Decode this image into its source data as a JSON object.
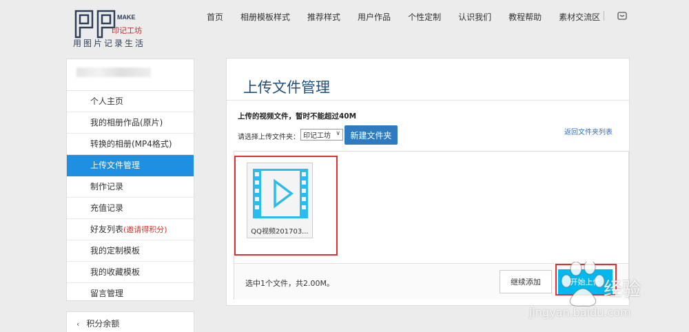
{
  "header": {
    "logo_text": "MAKE",
    "logo_brand": "印记工坊",
    "tagline": "用图片记录生活",
    "nav": [
      "首页",
      "相册模板样式",
      "推荐样式",
      "用户作品",
      "个性定制",
      "认识我们",
      "教程帮助",
      "素材交流区"
    ]
  },
  "sidebar": {
    "items": [
      {
        "label": "个人主页"
      },
      {
        "label": "我的相册作品(原片)"
      },
      {
        "label": "转换的相册(MP4格式)"
      },
      {
        "label": "上传文件管理"
      },
      {
        "label": "制作记录"
      },
      {
        "label": "充值记录"
      },
      {
        "label": "好友列表",
        "note": "(邀请得积分)"
      },
      {
        "label": "我的定制模板"
      },
      {
        "label": "我的收藏模板"
      },
      {
        "label": "留言管理"
      }
    ],
    "second_panel_label": "积分余额"
  },
  "main": {
    "title": "上传文件管理",
    "upload_note": "上传的视频文件，暂时不能超过40M",
    "folder_label": "请选择上传文件夹：",
    "folder_selected": "印记工坊",
    "new_folder_label": "新建文件夹",
    "back_link": "返回文件夹列表",
    "file_name": "QQ视频201703...",
    "selection_info": "选中1个文件，共2.00M。",
    "continue_label": "继续添加",
    "start_label": "开始上传"
  },
  "watermark": {
    "text": "经验",
    "url": "jingyan.baidu.com"
  },
  "colors": {
    "active": "#1e8fe1",
    "title": "#1f4e7b",
    "button": "#2e7cbf",
    "start": "#00b7ee",
    "highlight": "#e23030",
    "video_icon": "#2bbcee"
  }
}
